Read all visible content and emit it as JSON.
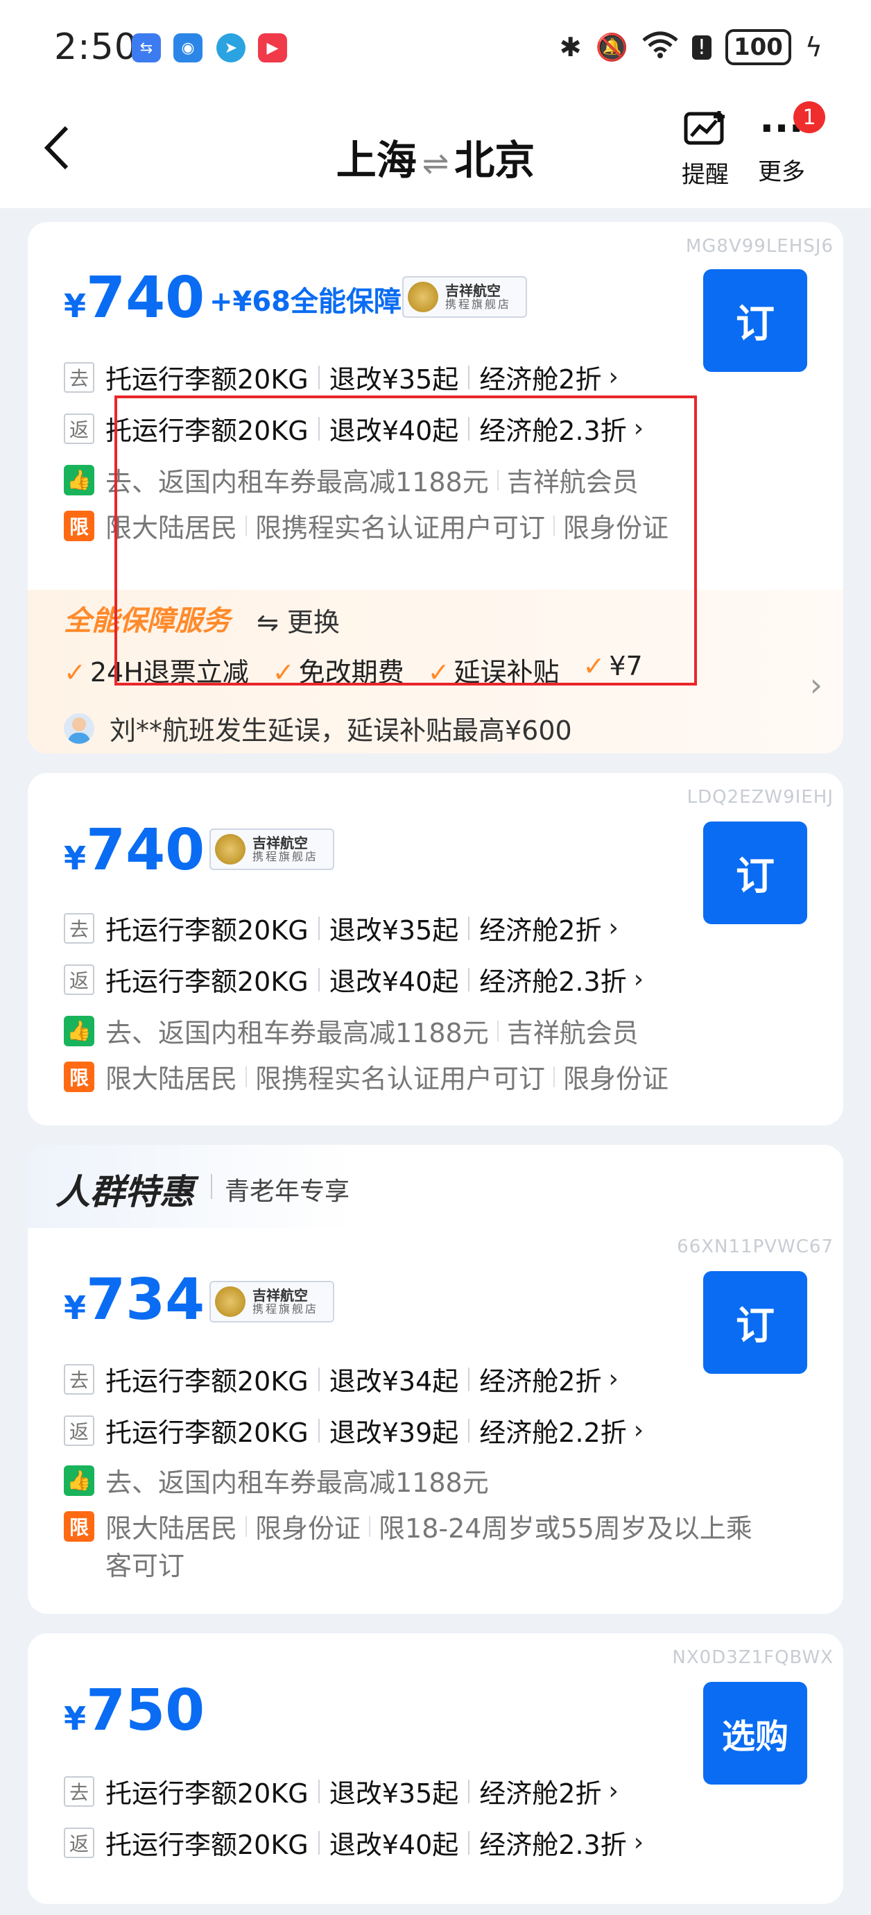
{
  "status_bar": {
    "time": "2:50",
    "battery": "100",
    "icons": [
      "bluetooth-icon",
      "bell-off-icon",
      "wifi-icon",
      "alert-icon",
      "battery-icon",
      "charging-icon"
    ]
  },
  "header": {
    "from": "上海",
    "to": "北京",
    "swap_glyph": "⇌",
    "remind_label": "提醒",
    "more_label": "更多",
    "badge_count": "1"
  },
  "cards": [
    {
      "code": "MG8V99LEHSJ6",
      "price_symbol": "¥",
      "price": "740",
      "addon": "+¥68全能保障",
      "airline_name": "吉祥航空",
      "airline_store": "携程旗舰店",
      "book_label": "订",
      "out_tag": "去",
      "out_baggage": "托运行李额20KG",
      "out_change": "退改¥35起",
      "out_cabin": "经济舱2折",
      "ret_tag": "返",
      "ret_baggage": "托运行李额20KG",
      "ret_change": "退改¥40起",
      "ret_cabin": "经济舱2.3折",
      "benefit": "去、返国内租车券最高减1188元",
      "benefit_member": "吉祥航会员",
      "limit_tag": "限",
      "limit1": "限大陆居民",
      "limit2": "限携程实名认证用户可订",
      "limit3": "限身份证",
      "service_title": "全能保障服务",
      "service_swap": "⇋ 更换",
      "service_items": [
        "24H退票立减",
        "免改期费",
        "延误补贴",
        "¥7"
      ],
      "notice": "刘**航班发生延误，延误补贴最高¥600"
    },
    {
      "code": "LDQ2EZW9IEHJ",
      "price_symbol": "¥",
      "price": "740",
      "airline_name": "吉祥航空",
      "airline_store": "携程旗舰店",
      "book_label": "订",
      "out_tag": "去",
      "out_baggage": "托运行李额20KG",
      "out_change": "退改¥35起",
      "out_cabin": "经济舱2折",
      "ret_tag": "返",
      "ret_baggage": "托运行李额20KG",
      "ret_change": "退改¥40起",
      "ret_cabin": "经济舱2.3折",
      "benefit": "去、返国内租车券最高减1188元",
      "benefit_member": "吉祥航会员",
      "limit_tag": "限",
      "limit1": "限大陆居民",
      "limit2": "限携程实名认证用户可订",
      "limit3": "限身份证"
    },
    {
      "promo_title": "人群特惠",
      "promo_sub": "青老年专享",
      "code": "66XN11PVWC67",
      "price_symbol": "¥",
      "price": "734",
      "airline_name": "吉祥航空",
      "airline_store": "携程旗舰店",
      "book_label": "订",
      "out_tag": "去",
      "out_baggage": "托运行李额20KG",
      "out_change": "退改¥34起",
      "out_cabin": "经济舱2折",
      "ret_tag": "返",
      "ret_baggage": "托运行李额20KG",
      "ret_change": "退改¥39起",
      "ret_cabin": "经济舱2.2折",
      "benefit": "去、返国内租车券最高减1188元",
      "limit_tag": "限",
      "limit1": "限大陆居民",
      "limit2": "限身份证",
      "limit3": "限18-24周岁或55周岁及以上乘",
      "limit3_cont": "客可订"
    },
    {
      "code": "NX0D3Z1FQBWX",
      "price_symbol": "¥",
      "price": "750",
      "book_label": "选购",
      "out_tag": "去",
      "out_baggage": "托运行李额20KG",
      "out_change": "退改¥35起",
      "out_cabin": "经济舱2折",
      "ret_tag": "返",
      "ret_baggage": "托运行李额20KG",
      "ret_change": "退改¥40起",
      "ret_cabin": "经济舱2.3折"
    }
  ],
  "colors": {
    "accent": "#0a6cf2",
    "service_orange": "#ff8a2a",
    "highlight_red": "#e8262a",
    "benefit_green": "#19b35b",
    "limit_orange": "#ff6a13"
  }
}
